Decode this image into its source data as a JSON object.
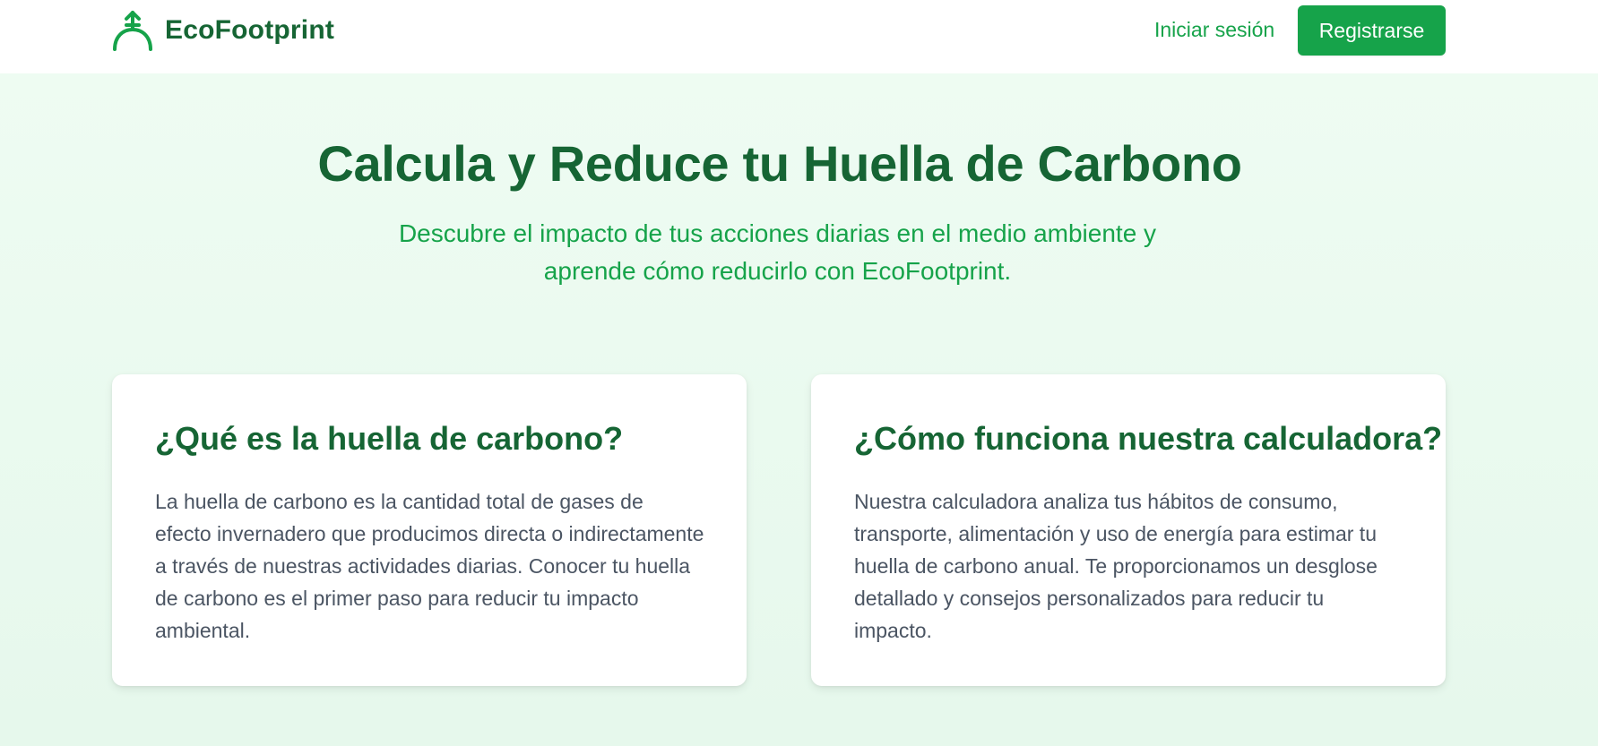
{
  "header": {
    "brand_name": "EcoFootprint",
    "brand_icon": "seedling-icon",
    "login_label": "Iniciar sesión",
    "register_label": "Registrarse"
  },
  "hero": {
    "title": "Calcula y Reduce tu Huella de Carbono",
    "subtitle": "Descubre el impacto de tus acciones diarias en el medio ambiente y aprende cómo reducirlo con EcoFootprint."
  },
  "cards": [
    {
      "title": "¿Qué es la huella de carbono?",
      "text": "La huella de carbono es la cantidad total de gases de efecto invernadero que producimos directa o indirectamente a través de nuestras actividades diarias. Conocer tu huella de carbono es el primer paso para reducir tu impacto ambiental."
    },
    {
      "title": "¿Cómo funciona nuestra calculadora?",
      "text": "Nuestra calculadora analiza tus hábitos de consumo, transporte, alimentación y uso de energía para estimar tu huella de carbono anual. Te proporcionamos un desglose detallado y consejos personalizados para reducir tu impacto."
    }
  ],
  "colors": {
    "primary": "#16a34a",
    "primary_dark": "#166534",
    "background": "#effcf3",
    "text_muted": "#4b5563"
  }
}
